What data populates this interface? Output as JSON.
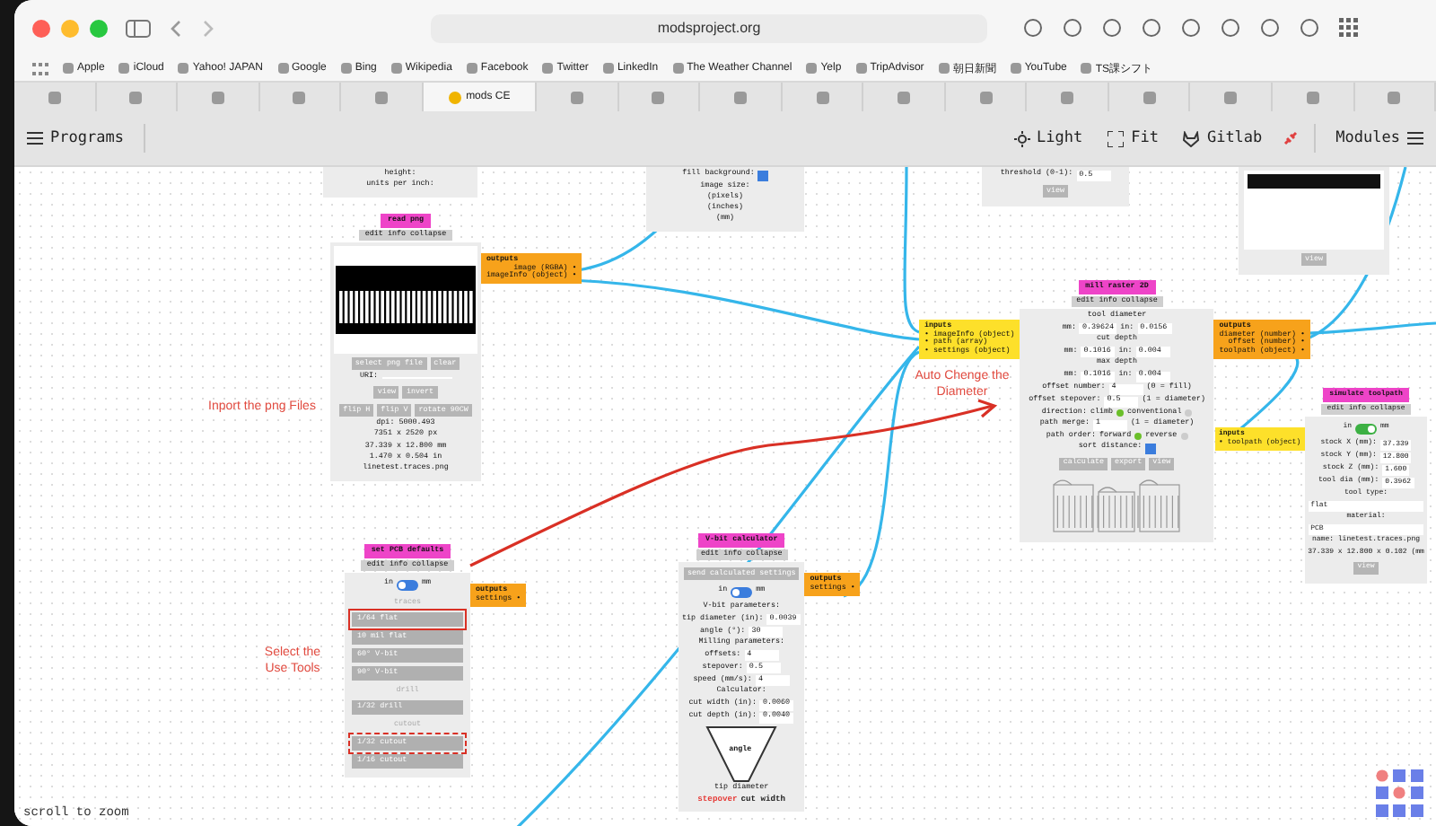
{
  "browser": {
    "url": "modsproject.org",
    "bookmarks": [
      {
        "label": "Apple"
      },
      {
        "label": "iCloud"
      },
      {
        "label": "Yahoo! JAPAN"
      },
      {
        "label": "Google"
      },
      {
        "label": "Bing"
      },
      {
        "label": "Wikipedia"
      },
      {
        "label": "Facebook"
      },
      {
        "label": "Twitter"
      },
      {
        "label": "LinkedIn"
      },
      {
        "label": "The Weather Channel"
      },
      {
        "label": "Yelp"
      },
      {
        "label": "TripAdvisor"
      },
      {
        "label": "朝日新聞"
      },
      {
        "label": "YouTube"
      },
      {
        "label": "TS課シフト"
      }
    ],
    "tabs": [
      {
        "selected": false
      },
      {
        "selected": false
      },
      {
        "selected": false
      },
      {
        "selected": false
      },
      {
        "selected": false
      },
      {
        "label": "mods CE",
        "selected": true
      },
      {
        "selected": false
      },
      {
        "selected": false
      },
      {
        "selected": false
      },
      {
        "selected": false
      },
      {
        "selected": false
      },
      {
        "selected": false
      },
      {
        "selected": false
      },
      {
        "selected": false
      },
      {
        "selected": false
      },
      {
        "selected": false
      },
      {
        "selected": false
      }
    ]
  },
  "toolbar": {
    "programs": "Programs",
    "actions": [
      {
        "kind": "sun",
        "label": "Light"
      },
      {
        "kind": "fit",
        "label": "Fit"
      },
      {
        "kind": "fox",
        "label": "Gitlab"
      }
    ],
    "modules": "Modules"
  },
  "canvas": {
    "nodes": [
      {
        "body": [
          {
            "kind": "text",
            "text": "height:"
          },
          {
            "kind": "text",
            "text": "units per inch:"
          }
        ]
      },
      {
        "body": [
          {
            "kind": "check",
            "label": "fill background:",
            "checked": true
          },
          {
            "kind": "text",
            "text": "image size:"
          },
          {
            "kind": "text",
            "text": "(pixels)"
          },
          {
            "kind": "text",
            "text": "(inches)"
          },
          {
            "kind": "text",
            "text": "(mm)"
          }
        ]
      },
      {
        "body": [
          {
            "kind": "field",
            "label": "threshold (0-1):",
            "value": "0.5"
          },
          {
            "kind": "buttons",
            "buttons": [
              {
                "label": "view"
              }
            ]
          }
        ]
      },
      {
        "body": [
          {
            "kind": "dark-image"
          },
          {
            "kind": "buttons",
            "buttons": [
              {
                "label": "view"
              }
            ]
          }
        ]
      },
      {
        "title": "read png",
        "links": [
          "edit",
          "info",
          "collapse"
        ],
        "outputs": {
          "label": "outputs",
          "ports": [
            "image (RGBA) •",
            "imageInfo (object) •"
          ]
        },
        "body": [
          {
            "kind": "traces-image"
          },
          {
            "kind": "buttons",
            "buttons": [
              {
                "label": "select png file"
              },
              {
                "label": "clear"
              }
            ]
          },
          {
            "kind": "input",
            "label": "URI:"
          },
          {
            "kind": "buttons",
            "buttons": [
              {
                "label": "view"
              },
              {
                "label": "invert"
              }
            ]
          },
          {
            "kind": "buttons",
            "buttons": [
              {
                "label": "flip H"
              },
              {
                "label": "flip V"
              },
              {
                "label": "rotate 90CW"
              }
            ]
          },
          {
            "kind": "text",
            "text": "dpi: 5000.493"
          },
          {
            "kind": "text",
            "text": "7351 x 2520 px"
          },
          {
            "kind": "text",
            "text": "37.339 x 12.800 mm"
          },
          {
            "kind": "text",
            "text": "1.470 x 0.504 in"
          },
          {
            "kind": "text",
            "text": "linetest.traces.png"
          }
        ]
      },
      {
        "title": "mill raster 2D",
        "links": [
          "edit",
          "info",
          "collapse"
        ],
        "inputs": {
          "label": "inputs",
          "ports": [
            "• imageInfo (object)",
            "• path (array)",
            "• settings (object)"
          ]
        },
        "outputs": {
          "label": "outputs",
          "ports": [
            "diameter (number) •",
            "offset (number) •",
            "toolpath (object) •"
          ]
        },
        "body": [
          {
            "kind": "text",
            "text": "tool diameter"
          },
          {
            "kind": "dual",
            "items": [
              {
                "label": "mm:",
                "value": "0.39624"
              },
              {
                "label": "in:",
                "value": "0.0156"
              }
            ]
          },
          {
            "kind": "text",
            "text": "cut depth"
          },
          {
            "kind": "dual",
            "items": [
              {
                "label": "mm:",
                "value": "0.1016"
              },
              {
                "label": "in:",
                "value": "0.004"
              }
            ]
          },
          {
            "kind": "text",
            "text": "max depth"
          },
          {
            "kind": "dual",
            "items": [
              {
                "label": "mm:",
                "value": "0.1016"
              },
              {
                "label": "in:",
                "value": "0.004"
              }
            ]
          },
          {
            "kind": "field",
            "label": "offset number:",
            "value": "4",
            "note": "(0 = fill)"
          },
          {
            "kind": "field",
            "label": "offset stepover:",
            "value": "0.5",
            "note": "(1 = diameter)"
          },
          {
            "kind": "radio",
            "label": "direction:",
            "options": [
              {
                "label": "climb",
                "selected": true
              },
              {
                "label": "conventional",
                "selected": false
              }
            ]
          },
          {
            "kind": "field",
            "label": "path merge:",
            "value": "1",
            "note": "(1 = diameter)"
          },
          {
            "kind": "radio",
            "label": "path order:",
            "options": [
              {
                "label": "forward",
                "selected": true
              },
              {
                "label": "reverse",
                "selected": false
              }
            ]
          },
          {
            "kind": "check",
            "label": "sort distance:",
            "checked": true
          },
          {
            "kind": "buttons",
            "buttons": [
              {
                "label": "calculate"
              },
              {
                "label": "export"
              },
              {
                "label": "view"
              }
            ]
          },
          {
            "kind": "toolpath-drawing"
          }
        ]
      },
      {
        "title": "simulate toolpath",
        "links": [
          "edit",
          "info",
          "collapse"
        ],
        "inputs": {
          "label": "inputs",
          "ports": [
            "• toolpath (object)"
          ]
        },
        "body": [
          {
            "kind": "toggle",
            "left": "in",
            "right": "mm",
            "on": true
          },
          {
            "kind": "field",
            "label": "stock X (mm):",
            "value": "37.339"
          },
          {
            "kind": "field",
            "label": "stock Y (mm):",
            "value": "12.800"
          },
          {
            "kind": "field",
            "label": "stock Z (mm):",
            "value": "1.600"
          },
          {
            "kind": "field",
            "label": "tool dia (mm):",
            "value": "0.3962"
          },
          {
            "kind": "text",
            "text": "tool type:"
          },
          {
            "kind": "select",
            "value": "flat"
          },
          {
            "kind": "text",
            "text": "material:"
          },
          {
            "kind": "select",
            "value": "PCB"
          },
          {
            "kind": "text",
            "text": "name: linetest.traces.png"
          },
          {
            "kind": "text",
            "text": "37.339 x 12.800 x 0.102 (mm"
          },
          {
            "kind": "buttons",
            "buttons": [
              {
                "label": "view"
              }
            ]
          }
        ]
      },
      {
        "title": "set PCB defaults",
        "links": [
          "edit",
          "info",
          "collapse"
        ],
        "outputs": {
          "label": "outputs",
          "ports": [
            "settings •"
          ]
        },
        "body": [
          {
            "kind": "toggle",
            "left": "in",
            "right": "mm",
            "on": false
          },
          {
            "kind": "section",
            "text": "traces"
          },
          {
            "kind": "tools",
            "buttons": [
              {
                "label": "1/64 flat",
                "kind": "solid-outline"
              },
              {
                "label": "10 mil flat",
                "kind": "plain"
              },
              {
                "label": "60° V-bit",
                "kind": "plain"
              },
              {
                "label": "90° V-bit",
                "kind": "plain"
              }
            ]
          },
          {
            "kind": "section",
            "text": "drill"
          },
          {
            "kind": "tools",
            "buttons": [
              {
                "label": "1/32 drill",
                "kind": "plain"
              }
            ]
          },
          {
            "kind": "section",
            "text": "cutout"
          },
          {
            "kind": "tools",
            "buttons": [
              {
                "label": "1/32 cutout",
                "kind": "dashed-outline"
              },
              {
                "label": "1/16 cutout",
                "kind": "plain"
              }
            ]
          }
        ]
      },
      {
        "title": "V-bit calculator",
        "links": [
          "edit",
          "info",
          "collapse"
        ],
        "outputs": {
          "label": "outputs",
          "ports": [
            "settings •"
          ]
        },
        "body": [
          {
            "kind": "buttons",
            "buttons": [
              {
                "label": "send calculated settings"
              }
            ]
          },
          {
            "kind": "toggle",
            "left": "in",
            "right": "mm",
            "on": false
          },
          {
            "kind": "text",
            "text": "V-bit parameters:"
          },
          {
            "kind": "field",
            "label": "tip diameter (in):",
            "value": "0.0039"
          },
          {
            "kind": "field",
            "label": "angle (°):",
            "value": "30"
          },
          {
            "kind": "text",
            "text": "Milling parameters:"
          },
          {
            "kind": "field",
            "label": "offsets:",
            "value": "4"
          },
          {
            "kind": "field",
            "label": "stepover:",
            "value": "0.5"
          },
          {
            "kind": "field",
            "label": "speed (mm/s):",
            "value": "4"
          },
          {
            "kind": "text",
            "text": "Calculator:"
          },
          {
            "kind": "field",
            "label": "cut width (in):",
            "value": "0.0060"
          },
          {
            "kind": "field",
            "label": "cut depth (in):",
            "value": "0.0040"
          },
          {
            "kind": "vbit-drawing",
            "label": "angle"
          },
          {
            "kind": "text",
            "text": "tip diameter"
          },
          {
            "kind": "legend",
            "items": [
              {
                "text": "stepover",
                "color": "#e53935"
              },
              {
                "text": "cut width",
                "color": "#222222"
              }
            ]
          }
        ]
      }
    ],
    "annotations": [
      {
        "text": "Inport the png Files"
      },
      {
        "text": "Auto Chenge the Diameter"
      },
      {
        "text": "Select the Use Tools"
      }
    ],
    "status": "scroll to zoom"
  }
}
